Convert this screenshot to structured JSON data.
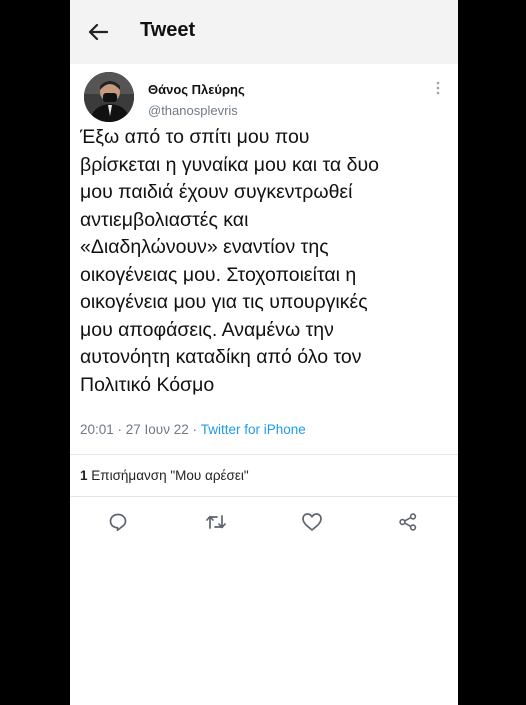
{
  "header": {
    "title": "Tweet",
    "back_icon": "arrow-left-icon"
  },
  "tweet": {
    "author_name": "Θάνος Πλεύρης",
    "author_handle": "@thanosplevris",
    "text": "Έξω από το σπίτι μου που\nβρίσκεται η γυναίκα μου και τα δυο\nμου παιδιά έχουν συγκεντρωθεί\nαντιεμβολιαστές και\n«Διαδηλώνουν» εναντίον της\nοικογένειας μου. Στοχοποιείται η\nοικογένεια μου για τις υπουργικές\nμου αποφάσεις. Αναμένω την\nαυτονόητη καταδίκη από όλο τον\nΠολιτικό Κόσμο",
    "time": "20:01 · 27 Ιουν 22 · ",
    "source": "Twitter for iPhone"
  },
  "stats": {
    "likes_count": "1",
    "likes_label": " Επισήμανση \"Μου αρέσει\""
  },
  "actions": [
    "reply-icon",
    "retweet-icon",
    "like-icon",
    "share-icon"
  ],
  "colors": {
    "link": "#1d9bf0",
    "secondary_text": "#6e7a84",
    "icon": "#5b6570"
  }
}
